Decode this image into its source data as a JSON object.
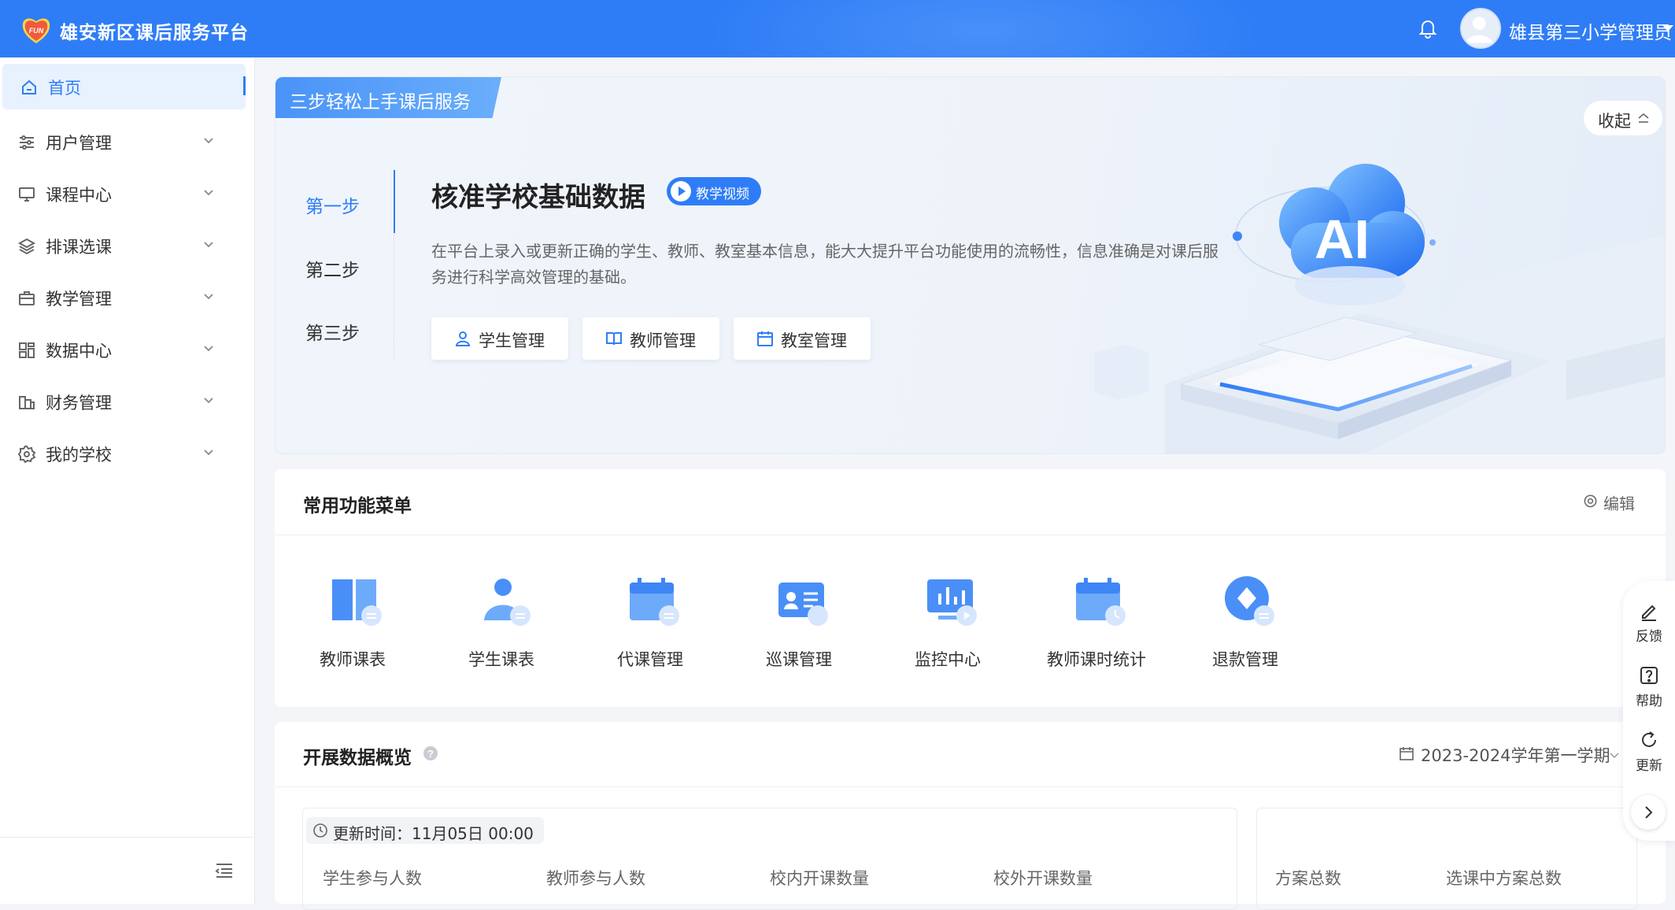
{
  "app": {
    "title": "雄安新区课后服务平台",
    "logo_text": "FUN"
  },
  "header": {
    "user_name": "雄县第三小学管理员",
    "bell_icon": "bell-icon"
  },
  "sidebar": {
    "items": [
      {
        "label": "首页",
        "icon": "home-icon",
        "active": true
      },
      {
        "label": "用户管理",
        "icon": "sliders-icon"
      },
      {
        "label": "课程中心",
        "icon": "monitor-icon"
      },
      {
        "label": "排课选课",
        "icon": "layers-icon"
      },
      {
        "label": "教学管理",
        "icon": "briefcase-icon"
      },
      {
        "label": "数据中心",
        "icon": "dashboard-icon"
      },
      {
        "label": "财务管理",
        "icon": "finance-icon"
      },
      {
        "label": "我的学校",
        "icon": "gear-icon"
      }
    ]
  },
  "banner": {
    "tag": "三步轻松上手课后服务",
    "collapse_label": "收起",
    "steps": [
      "第一步",
      "第二步",
      "第三步"
    ],
    "title": "核准学校基础数据",
    "video_badge": "教学视频",
    "desc": "在平台上录入或更新正确的学生、教师、教室基本信息，能大大提升平台功能使用的流畅性，信息准确是对课后服务进行科学高效管理的基础。",
    "buttons": [
      "学生管理",
      "教师管理",
      "教室管理"
    ],
    "illustration_text": "AI"
  },
  "menu_card": {
    "title": "常用功能菜单",
    "edit_label": "编辑",
    "items": [
      "教师课表",
      "学生课表",
      "代课管理",
      "巡课管理",
      "监控中心",
      "教师课时统计",
      "退款管理"
    ]
  },
  "overview": {
    "title": "开展数据概览",
    "term": "2023-2024学年第一学期",
    "update_time": "更新时间：11月05日 00:00",
    "stats_left": [
      "学生参与人数",
      "教师参与人数",
      "校内开课数量",
      "校外开课数量"
    ],
    "stats_right": [
      "方案总数",
      "选课中方案总数"
    ]
  },
  "float_bar": {
    "items": [
      "反馈",
      "帮助",
      "更新"
    ]
  },
  "colors": {
    "primary": "#2f7df6",
    "sidebar_active_bg": "#e8f1fe"
  }
}
